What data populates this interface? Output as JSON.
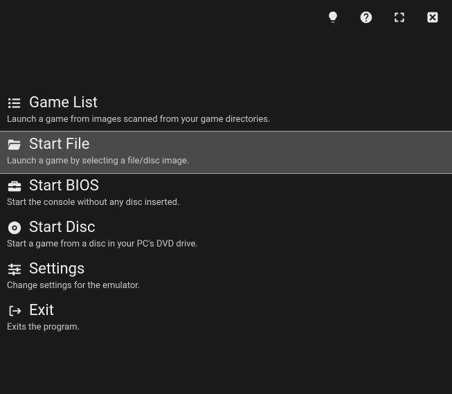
{
  "topbar": {
    "icons": [
      "lightbulb-icon",
      "help-icon",
      "fullscreen-icon",
      "close-icon"
    ]
  },
  "menu": {
    "items": [
      {
        "icon": "list-icon",
        "title": "Game List",
        "desc": "Launch a game from images scanned from your game directories.",
        "selected": false
      },
      {
        "icon": "folder-open-icon",
        "title": "Start File",
        "desc": "Launch a game by selecting a file/disc image.",
        "selected": true
      },
      {
        "icon": "toolbox-icon",
        "title": "Start BIOS",
        "desc": "Start the console without any disc inserted.",
        "selected": false
      },
      {
        "icon": "disc-icon",
        "title": "Start Disc",
        "desc": "Start a game from a disc in your PC's DVD drive.",
        "selected": false
      },
      {
        "icon": "sliders-icon",
        "title": "Settings",
        "desc": "Change settings for the emulator.",
        "selected": false
      },
      {
        "icon": "exit-icon",
        "title": "Exit",
        "desc": "Exits the program.",
        "selected": false
      }
    ]
  }
}
